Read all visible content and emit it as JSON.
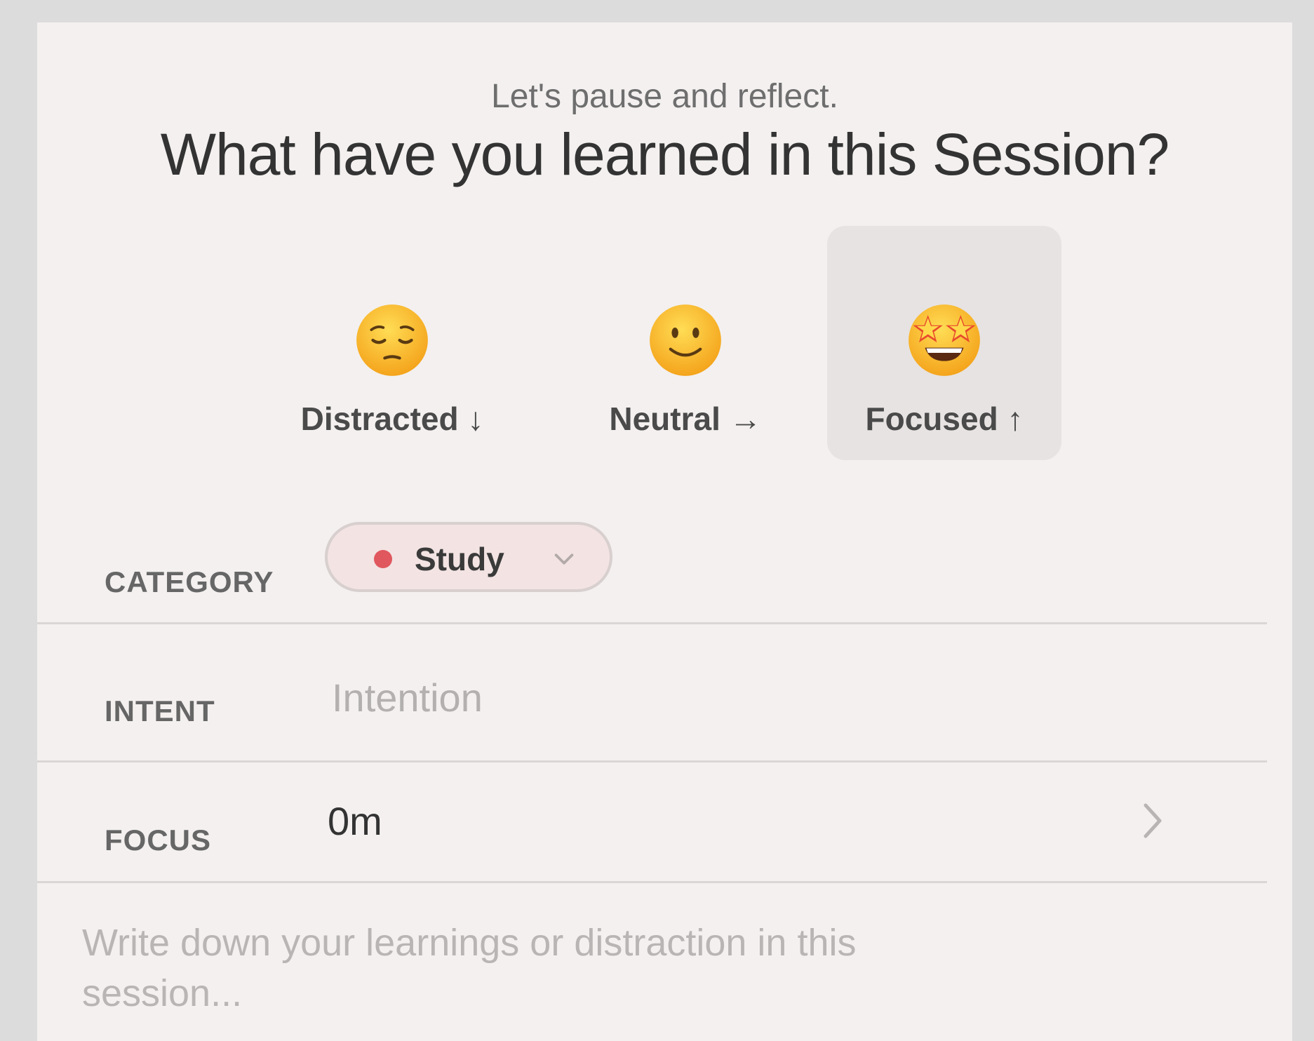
{
  "header": {
    "subtitle": "Let's pause and reflect.",
    "title": "What have you learned in this Session?"
  },
  "moods": [
    {
      "label": "Distracted ↓",
      "icon": "pensive-face-icon",
      "selected": false
    },
    {
      "label": "Neutral →",
      "icon": "slightly-smiling-face-icon",
      "selected": false
    },
    {
      "label": "Focused ↑",
      "icon": "star-struck-face-icon",
      "selected": true
    }
  ],
  "category": {
    "label": "CATEGORY",
    "value": "Study",
    "color": "#e0575d"
  },
  "intent": {
    "label": "INTENT",
    "placeholder": "Intention",
    "value": ""
  },
  "focus": {
    "label": "FOCUS",
    "value": "0m"
  },
  "notes": {
    "placeholder": "Write down your learnings or distraction in this session..."
  },
  "colors": {
    "window_bg": "#dcdcdc",
    "panel_bg": "#f3f0ef",
    "selected_mood_bg": "#e7e3e2",
    "pill_bg": "#f3e3e3"
  }
}
